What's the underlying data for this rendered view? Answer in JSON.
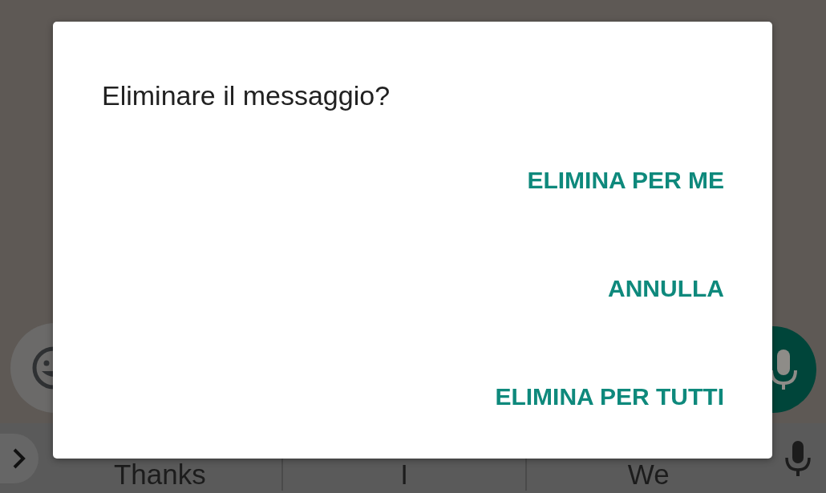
{
  "dialog": {
    "title": "Eliminare il messaggio?",
    "actions": [
      {
        "label": "ELIMINA PER ME"
      },
      {
        "label": "ANNULLA"
      },
      {
        "label": "ELIMINA PER TUTTI"
      }
    ]
  },
  "keyboard": {
    "suggestions": [
      "Thanks",
      "I",
      "We"
    ]
  }
}
